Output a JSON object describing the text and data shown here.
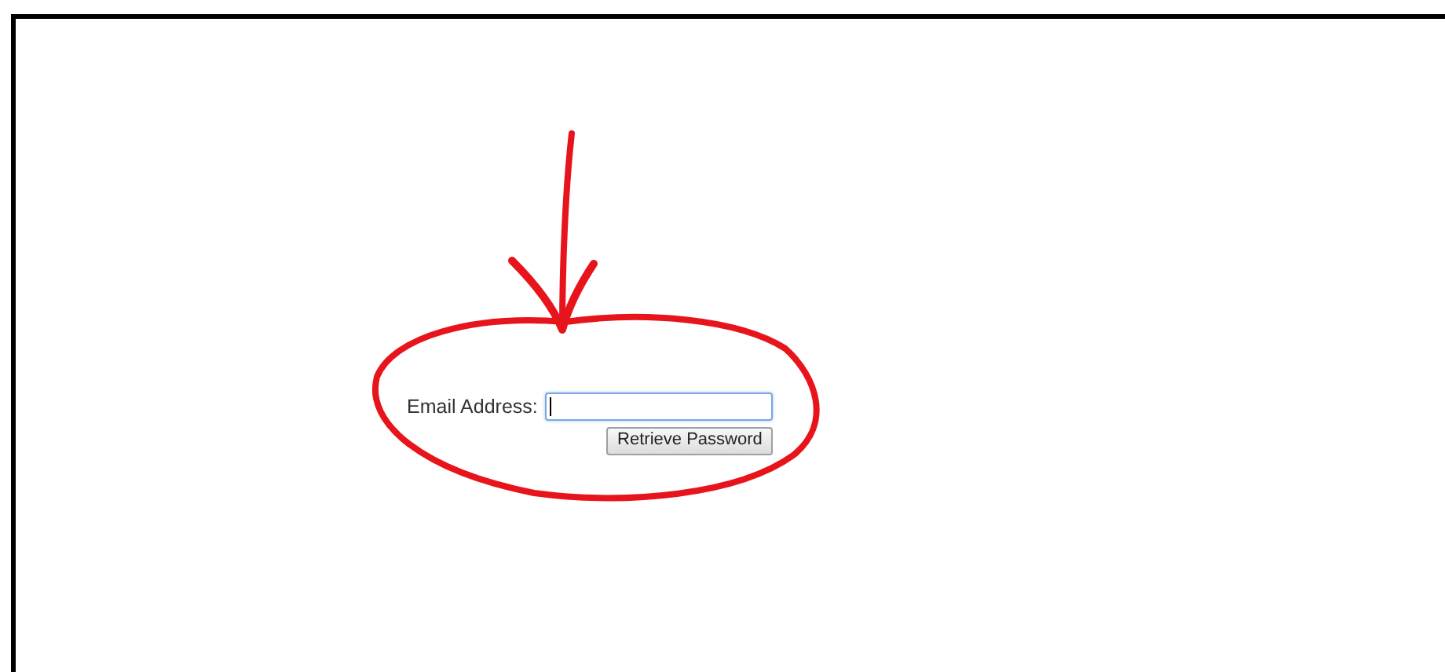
{
  "form": {
    "label": "Email Address:",
    "button": "Retrieve Password"
  }
}
